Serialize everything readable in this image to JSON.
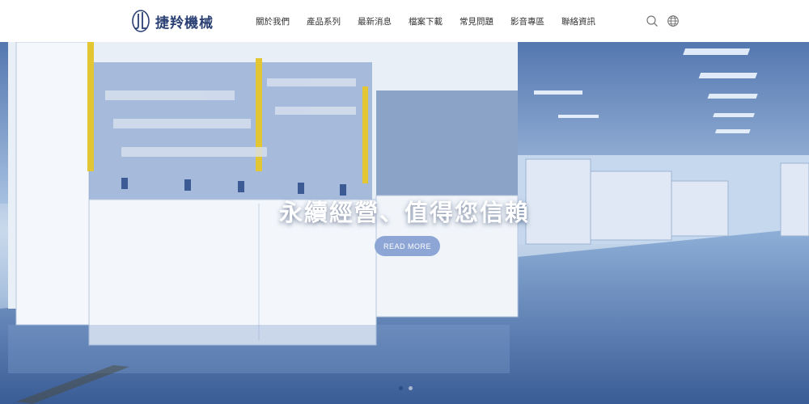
{
  "header": {
    "logo_text": "捷羚機械",
    "nav": [
      {
        "label": "關於我們"
      },
      {
        "label": "產品系列"
      },
      {
        "label": "最新消息"
      },
      {
        "label": "檔案下載"
      },
      {
        "label": "常見問題"
      },
      {
        "label": "影音專區"
      },
      {
        "label": "聯絡資訊"
      }
    ],
    "icons": [
      "search-icon",
      "globe-icon"
    ]
  },
  "hero": {
    "title": "永續經營、值得您信賴",
    "button_label": "READ MORE",
    "slides": {
      "count": 2,
      "active": 1
    }
  },
  "colors": {
    "brand": "#2a3f73",
    "button": "#8ea6d6",
    "active_dot": "#2d4b8a"
  }
}
